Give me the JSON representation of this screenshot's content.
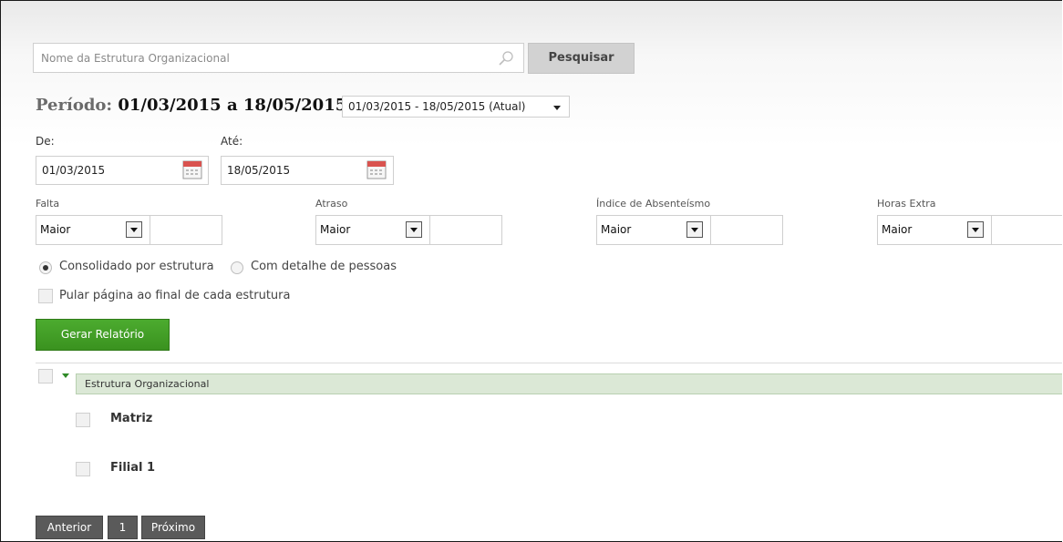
{
  "search": {
    "placeholder": "Nome da Estrutura Organizacional",
    "button_label": "Pesquisar"
  },
  "period": {
    "label": "Período:",
    "range_text": "01/03/2015 a 18/05/2015",
    "select_value": "01/03/2015 - 18/05/2015 (Atual)"
  },
  "dates": {
    "from_label": "De:",
    "from_value": "01/03/2015",
    "to_label": "Até:",
    "to_value": "18/05/2015"
  },
  "filters": [
    {
      "label": "Falta",
      "operator": "Maior"
    },
    {
      "label": "Atraso",
      "operator": "Maior"
    },
    {
      "label": "Índice de Absenteísmo",
      "operator": "Maior"
    },
    {
      "label": "Horas Extra",
      "operator": "Maior"
    }
  ],
  "options": {
    "radio_consolidated": "Consolidado por estrutura",
    "radio_detail": "Com detalhe de pessoas",
    "checkbox_page_break": "Pular página ao final de cada estrutura"
  },
  "generate_button": "Gerar Relatório",
  "tree": {
    "header": "Estrutura Organizacional",
    "items": [
      {
        "label": "Matriz"
      },
      {
        "label": "Filial 1"
      }
    ]
  },
  "pagination": {
    "prev": "Anterior",
    "page": "1",
    "next": "Próximo"
  },
  "colors": {
    "accent_green": "#3a921f",
    "header_green": "#dbe8d6",
    "pager_gray": "#5a5a5a"
  },
  "icons": {
    "search": "search-icon",
    "calendar": "calendar-icon",
    "dropdown": "chevron-down-icon"
  }
}
